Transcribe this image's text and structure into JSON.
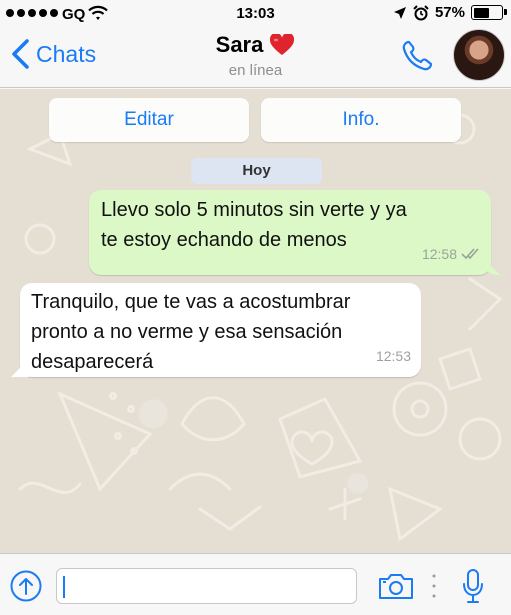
{
  "status_bar": {
    "carrier": "GQ",
    "time": "13:03",
    "battery": "57%",
    "battery_level": 0.57,
    "icons": [
      "signal-dots-icon",
      "wifi-icon",
      "location-arrow-icon",
      "alarm-clock-icon",
      "battery-icon"
    ]
  },
  "nav": {
    "back_label": "Chats",
    "contact_name": "Sara",
    "contact_emoji": "heart-emoji-icon",
    "contact_status": "en línea",
    "accent_color": "#1a7cf5"
  },
  "chat": {
    "actions": {
      "edit_label": "Editar",
      "info_label": "Info."
    },
    "date_label": "Hoy",
    "messages": [
      {
        "direction": "outgoing",
        "text_line1": "Llevo solo 5 minutos sin verte y ya",
        "text_line2": "te estoy echando de menos",
        "time": "12:58",
        "status": "read-double-check",
        "bubble_color": "#dcf8c6"
      },
      {
        "direction": "incoming",
        "text_line1": "Tranquilo, que te vas a acostumbrar",
        "text_line2": "pronto a no verme y esa sensación",
        "text_line3": "desaparecerá",
        "time": "12:53",
        "bubble_color": "#ffffff"
      }
    ]
  },
  "input_bar": {
    "message_value": "",
    "icons": [
      "upload-arrow-icon",
      "camera-icon",
      "microphone-icon"
    ]
  }
}
